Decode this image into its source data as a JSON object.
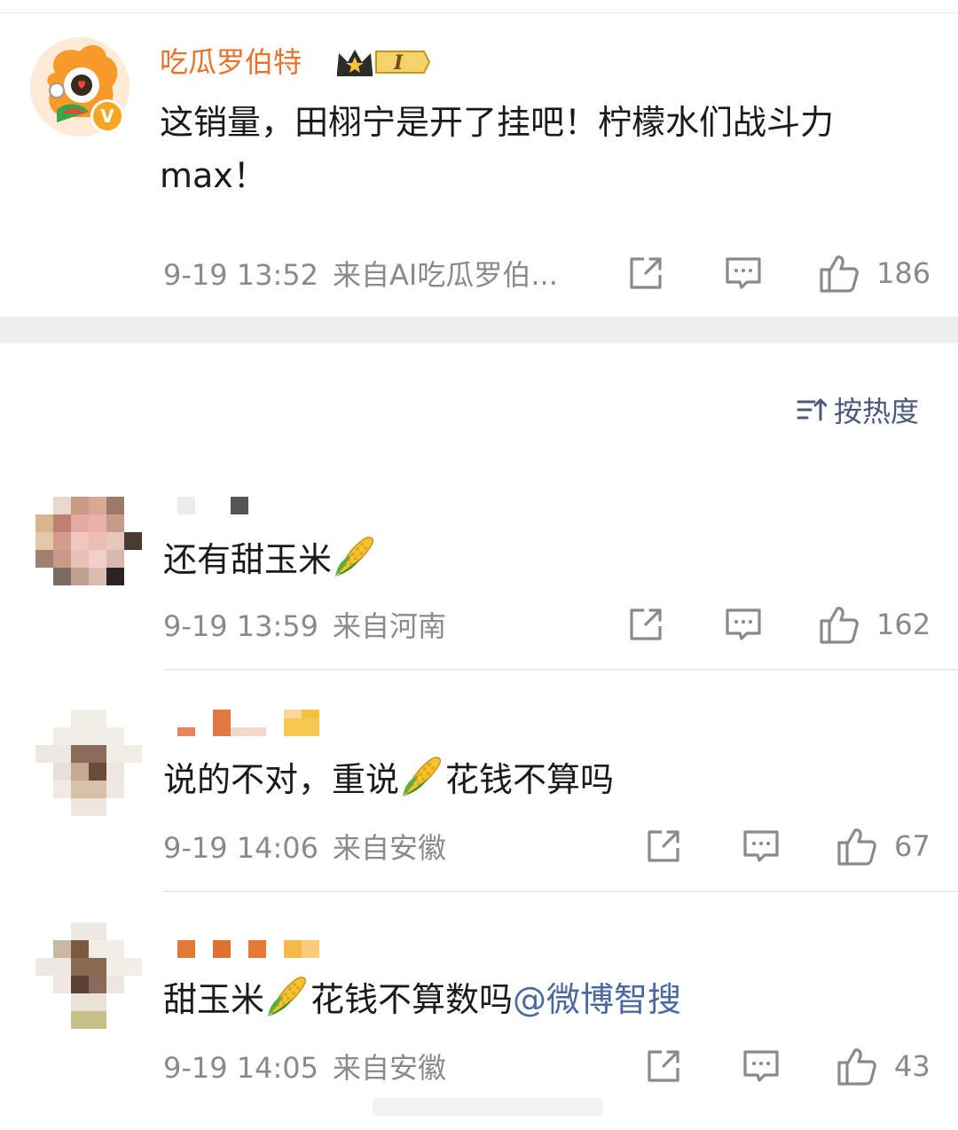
{
  "post": {
    "author": "吃瓜罗伯特",
    "level_badge": "I",
    "text": "这销量，田栩宁是开了挂吧！柠檬水们战斗力max！",
    "time": "9-19 13:52",
    "source": "来自AI吃瓜罗伯...",
    "likes": "186",
    "verified_symbol": "V"
  },
  "sort": {
    "label": "按热度"
  },
  "comments": [
    {
      "text": "还有甜玉米",
      "time": "9-19 13:59",
      "source": "来自河南",
      "likes": "162"
    },
    {
      "text_a": "说的不对，重说",
      "text_b": "花钱不算吗",
      "time": "9-19 14:06",
      "source": "来自安徽",
      "likes": "67"
    },
    {
      "text_a": "甜玉米",
      "text_b": "花钱不算数吗",
      "mention": "@微博智搜",
      "time": "9-19 14:05",
      "source": "来自安徽",
      "likes": "43"
    }
  ],
  "colors": {
    "author_name": "#e8722a",
    "mention": "#4a6a9e",
    "meta": "#8a8a8a",
    "sort": "#4a5a78"
  },
  "icons": [
    "share-icon",
    "comment-icon",
    "like-icon",
    "sort-icon",
    "corn-emoji",
    "crown-icon",
    "verified-icon"
  ]
}
